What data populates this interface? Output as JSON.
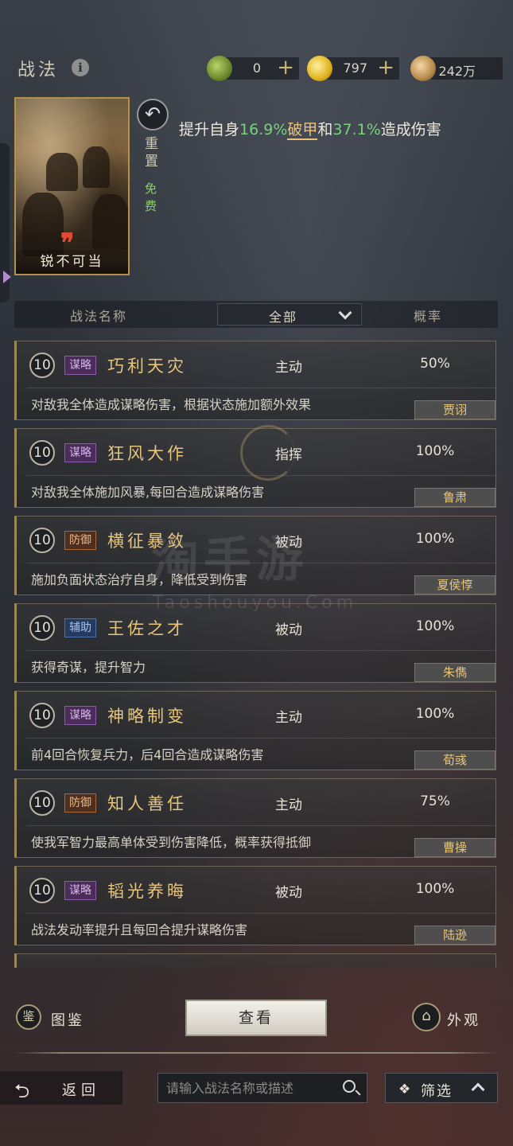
{
  "header": {
    "title": "战法",
    "info_icon": "i",
    "currencies": [
      {
        "icon": "jade-coin-icon",
        "value": "0",
        "plus": "+"
      },
      {
        "icon": "gold-coin-icon",
        "value": "797",
        "plus": "+"
      },
      {
        "icon": "copper-coin-icon",
        "value": "242万"
      }
    ]
  },
  "skill_card": {
    "name": "锐不可当",
    "reset_label": "重置",
    "free_label": "免费",
    "desc_prefix": "提升自身",
    "desc_pct1": "16.9%",
    "desc_kw": "破甲",
    "desc_mid": "和",
    "desc_pct2": "37.1%",
    "desc_suffix": "造成伤害"
  },
  "columns": {
    "name": "战法名称",
    "filter": "全部",
    "rate": "概率"
  },
  "tactics": [
    {
      "level": "10",
      "tag": "谋略",
      "tag_kind": "mou",
      "name": "巧利天灾",
      "type": "主动",
      "rate": "50%",
      "desc": "对敌我全体造成谋略伤害，根据状态施加额外效果",
      "hero": "贾诩"
    },
    {
      "level": "10",
      "tag": "谋略",
      "tag_kind": "mou",
      "name": "狂风大作",
      "type": "指挥",
      "rate": "100%",
      "desc": "对敌我全体施加风暴,每回合造成谋略伤害",
      "hero": "鲁肃"
    },
    {
      "level": "10",
      "tag": "防御",
      "tag_kind": "fang",
      "name": "横征暴敛",
      "type": "被动",
      "rate": "100%",
      "desc": "施加负面状态治疗自身，降低受到伤害",
      "hero": "夏侯惇"
    },
    {
      "level": "10",
      "tag": "辅助",
      "tag_kind": "fu",
      "name": "王佐之才",
      "type": "被动",
      "rate": "100%",
      "desc": "获得奇谋，提升智力",
      "hero": "朱儁"
    },
    {
      "level": "10",
      "tag": "谋略",
      "tag_kind": "mou",
      "name": "神略制变",
      "type": "主动",
      "rate": "100%",
      "desc": "前4回合恢复兵力，后4回合造成谋略伤害",
      "hero": "荀彧"
    },
    {
      "level": "10",
      "tag": "防御",
      "tag_kind": "fang",
      "name": "知人善任",
      "type": "主动",
      "rate": "75%",
      "desc": "使我军智力最高单体受到伤害降低，概率获得抵御",
      "hero": "曹操"
    },
    {
      "level": "10",
      "tag": "谋略",
      "tag_kind": "mou",
      "name": "韬光养晦",
      "type": "被动",
      "rate": "100%",
      "desc": "战法发动率提升且每回合提升谋略伤害",
      "hero": "陆逊"
    }
  ],
  "watermark": {
    "main": "淘手游",
    "sub": "Taoshouyou.Com"
  },
  "actions": {
    "tujian": "图鉴",
    "view": "查看",
    "waiguan": "外观"
  },
  "footer": {
    "back": "返回",
    "search_placeholder": "请输入战法名称或描述",
    "filter": "筛选"
  }
}
